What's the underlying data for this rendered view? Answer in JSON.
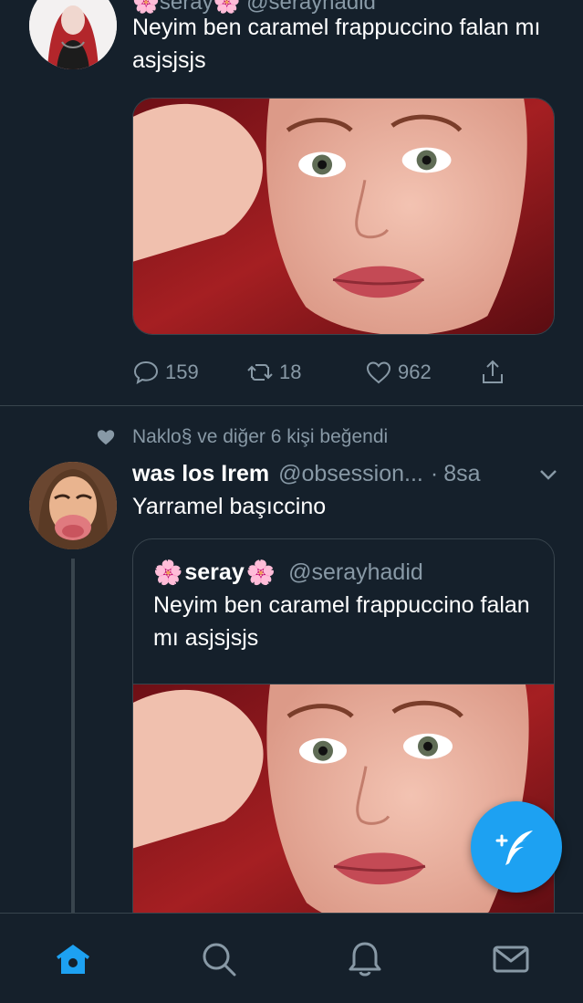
{
  "tweet1": {
    "header_peek": "🌸seray🌸 @serayhadid",
    "text": "Neyim ben caramel frappuccino falan mı asjsjsjs",
    "actions": {
      "replies": "159",
      "retweets": "18",
      "likes": "962"
    },
    "icons": [
      "reply-icon",
      "retweet-icon",
      "like-icon",
      "share-icon"
    ]
  },
  "tweet2": {
    "social_context": "Naklo§ ve diğer 6 kişi beğendi",
    "name": "was los Irem",
    "handle": "@obsession...",
    "dot": "·",
    "time": "8sa",
    "text": "Yarramel başıccino",
    "quote": {
      "flower": "🌸",
      "name": "seray",
      "handle": "@serayhadid",
      "text": "Neyim ben caramel frappuccino falan mı asjsjsjs"
    }
  },
  "nav": {
    "tabs": [
      "home-icon",
      "search-icon",
      "notifications-icon",
      "messages-icon"
    ],
    "active": "home-icon"
  },
  "colors": {
    "background": "#15202b",
    "border": "#38444d",
    "secondary_text": "#8899a6",
    "accent": "#1da1f2"
  }
}
